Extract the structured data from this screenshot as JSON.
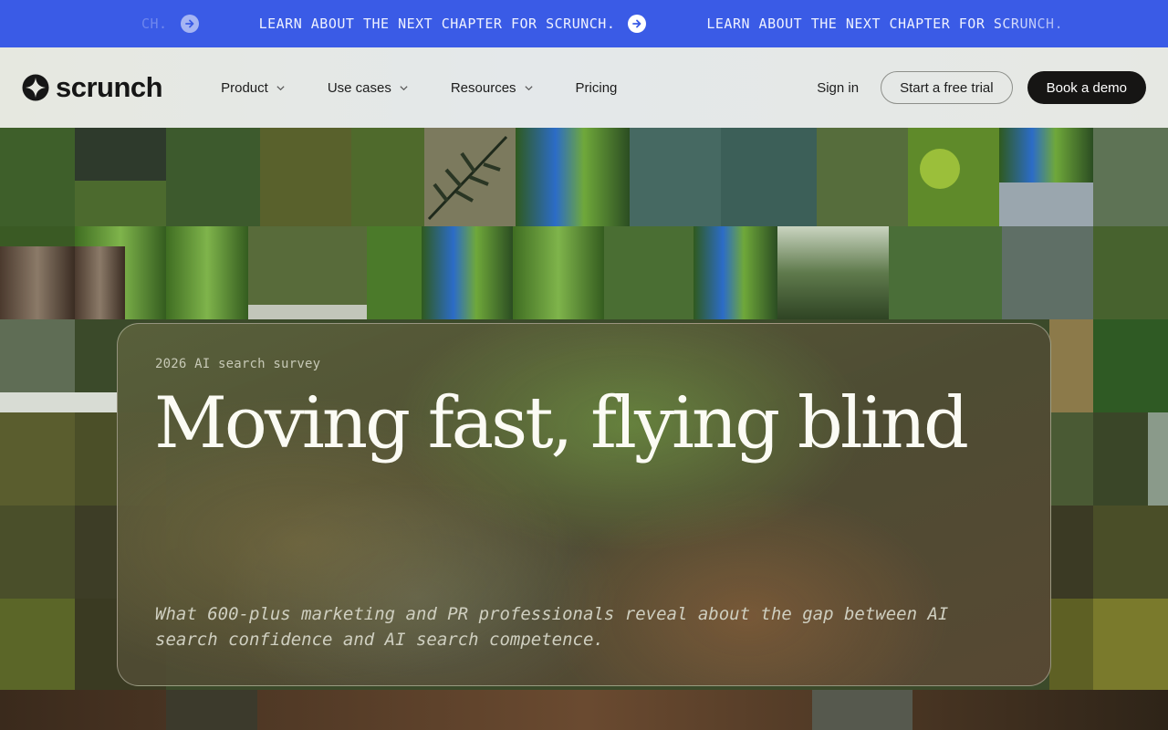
{
  "banner": {
    "text": "Learn about the next chapter for Scrunch.",
    "partial_left": "CH.",
    "background": "#3a5be6"
  },
  "navbar": {
    "brand": "scrunch",
    "menu": [
      {
        "label": "Product",
        "has_dropdown": true
      },
      {
        "label": "Use cases",
        "has_dropdown": true
      },
      {
        "label": "Resources",
        "has_dropdown": true
      },
      {
        "label": "Pricing",
        "has_dropdown": false
      }
    ],
    "sign_in": "Sign in",
    "trial_button": "Start a free trial",
    "demo_button": "Book a demo"
  },
  "hero": {
    "eyebrow": "2026 AI search survey",
    "headline": "Moving fast, flying blind",
    "subtitle": "What 600-plus marketing and PR professionals reveal about the gap between AI search confidence and AI search competence."
  },
  "icons": {
    "banner_arrow": "arrow-right-circle-icon",
    "logo": "scrunch-star-icon",
    "dropdown": "chevron-down-icon"
  },
  "colors": {
    "accent_blue": "#3a5be6",
    "dark_button": "#161514"
  }
}
